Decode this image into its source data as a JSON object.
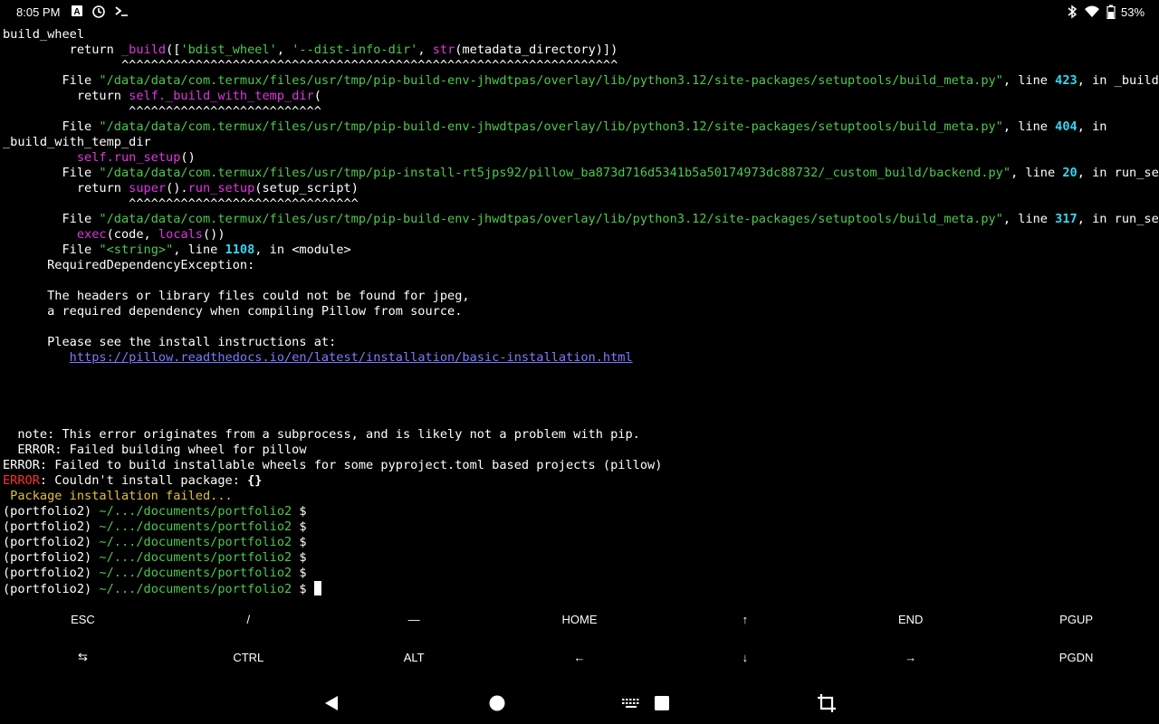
{
  "status_bar": {
    "time": "8:05 PM",
    "left_icons": [
      "a-box-icon",
      "sync-icon",
      "terminal-prompt-icon"
    ],
    "right_icons": [
      "bluetooth-icon",
      "wifi-icon",
      "battery-icon"
    ],
    "battery": "53%"
  },
  "terminal": {
    "lines": [
      [
        {
          "t": "build_wheel"
        }
      ],
      [
        {
          "t": "         return "
        },
        {
          "t": "_build",
          "c": "m"
        },
        {
          "t": "(["
        },
        {
          "t": "'bdist_wheel'",
          "c": "g"
        },
        {
          "t": ", "
        },
        {
          "t": "'--dist-info-dir'",
          "c": "g"
        },
        {
          "t": ", "
        },
        {
          "t": "str",
          "c": "m"
        },
        {
          "t": "(metadata_directory)])"
        }
      ],
      [
        {
          "t": "                ^^^^^^^^^^^^^^^^^^^^^^^^^^^^^^^^^^^^^^^^^^^^^^^^^^^^^^^^^^^^^^^^^^^"
        }
      ],
      [
        {
          "t": "        File "
        },
        {
          "t": "\"/data/data/com.termux/files/usr/tmp/pip-build-env-jhwdtpas/overlay/lib/python3.12/site-packages/setuptools/build_meta.py\"",
          "c": "g"
        },
        {
          "t": ", line "
        },
        {
          "t": "423",
          "c": "c"
        },
        {
          "t": ", in _build"
        }
      ],
      [
        {
          "t": "          return "
        },
        {
          "t": "self._build_with_temp_dir",
          "c": "m"
        },
        {
          "t": "("
        }
      ],
      [
        {
          "t": "                 ^^^^^^^^^^^^^^^^^^^^^^^^^^"
        }
      ],
      [
        {
          "t": "        File "
        },
        {
          "t": "\"/data/data/com.termux/files/usr/tmp/pip-build-env-jhwdtpas/overlay/lib/python3.12/site-packages/setuptools/build_meta.py\"",
          "c": "g"
        },
        {
          "t": ", line "
        },
        {
          "t": "404",
          "c": "c"
        },
        {
          "t": ", in"
        }
      ],
      [
        {
          "t": "_build_with_temp_dir"
        }
      ],
      [
        {
          "t": "          "
        },
        {
          "t": "self.run_setup",
          "c": "m"
        },
        {
          "t": "()"
        }
      ],
      [
        {
          "t": "        File "
        },
        {
          "t": "\"/data/data/com.termux/files/usr/tmp/pip-install-rt5jps92/pillow_ba873d716d5341b5a50174973dc88732/_custom_build/backend.py\"",
          "c": "g"
        },
        {
          "t": ", line "
        },
        {
          "t": "20",
          "c": "c"
        },
        {
          "t": ", in run_setup"
        }
      ],
      [
        {
          "t": "          return "
        },
        {
          "t": "super",
          "c": "m"
        },
        {
          "t": "()."
        },
        {
          "t": "run_setup",
          "c": "m"
        },
        {
          "t": "(setup_script)"
        }
      ],
      [
        {
          "t": "                 ^^^^^^^^^^^^^^^^^^^^^^^^^^^^^^^"
        }
      ],
      [
        {
          "t": "        File "
        },
        {
          "t": "\"/data/data/com.termux/files/usr/tmp/pip-build-env-jhwdtpas/overlay/lib/python3.12/site-packages/setuptools/build_meta.py\"",
          "c": "g"
        },
        {
          "t": ", line "
        },
        {
          "t": "317",
          "c": "c"
        },
        {
          "t": ", in run_setup"
        }
      ],
      [
        {
          "t": "          "
        },
        {
          "t": "exec",
          "c": "m"
        },
        {
          "t": "(code, "
        },
        {
          "t": "locals",
          "c": "m"
        },
        {
          "t": "())"
        }
      ],
      [
        {
          "t": "        File "
        },
        {
          "t": "\"<string>\"",
          "c": "g"
        },
        {
          "t": ", line "
        },
        {
          "t": "1108",
          "c": "c"
        },
        {
          "t": ", in <module>"
        }
      ],
      [
        {
          "t": "      RequiredDependencyException:"
        }
      ],
      [
        {
          "t": ""
        }
      ],
      [
        {
          "t": "      The headers or library files could not be found for jpeg,"
        }
      ],
      [
        {
          "t": "      a required dependency when compiling Pillow from source."
        }
      ],
      [
        {
          "t": ""
        }
      ],
      [
        {
          "t": "      Please see the install instructions at:"
        }
      ],
      [
        {
          "t": "         "
        },
        {
          "t": "https://pillow.readthedocs.io/en/latest/installation/basic-installation.html",
          "c": "link"
        }
      ],
      [
        {
          "t": ""
        }
      ],
      [
        {
          "t": ""
        }
      ],
      [
        {
          "t": ""
        }
      ],
      [
        {
          "t": ""
        }
      ],
      [
        {
          "t": "  note: This error originates from a subprocess, and is likely not a problem with pip."
        }
      ],
      [
        {
          "t": "  ERROR: Failed building wheel for pillow"
        }
      ],
      [
        {
          "t": "ERROR: Failed to build installable wheels for some pyproject.toml based projects (pillow)"
        }
      ],
      [
        {
          "t": "ERROR",
          "c": "r"
        },
        {
          "t": ": Couldn't install package: "
        },
        {
          "t": "{}",
          "c": "b"
        }
      ],
      [
        {
          "t": " Package installation failed...",
          "c": "y"
        }
      ],
      [
        {
          "t": "(portfolio2) "
        },
        {
          "t": "~/.../documents/portfolio2",
          "c": "g"
        },
        {
          "t": " $"
        }
      ],
      [
        {
          "t": "(portfolio2) "
        },
        {
          "t": "~/.../documents/portfolio2",
          "c": "g"
        },
        {
          "t": " $"
        }
      ],
      [
        {
          "t": "(portfolio2) "
        },
        {
          "t": "~/.../documents/portfolio2",
          "c": "g"
        },
        {
          "t": " $"
        }
      ],
      [
        {
          "t": "(portfolio2) "
        },
        {
          "t": "~/.../documents/portfolio2",
          "c": "g"
        },
        {
          "t": " $"
        }
      ],
      [
        {
          "t": "(portfolio2) "
        },
        {
          "t": "~/.../documents/portfolio2",
          "c": "g"
        },
        {
          "t": " $"
        }
      ],
      [
        {
          "t": "(portfolio2) "
        },
        {
          "t": "~/.../documents/portfolio2",
          "c": "g"
        },
        {
          "t": " $ "
        },
        {
          "cursor": true
        }
      ]
    ]
  },
  "extra_keys": {
    "row1": [
      "ESC",
      "/",
      "—",
      "HOME",
      "↑",
      "END",
      "PGUP"
    ],
    "row2": [
      "⇆",
      "CTRL",
      "ALT",
      "←",
      "↓",
      "→",
      "PGDN"
    ]
  },
  "nav_bar": {
    "buttons": [
      "back-icon",
      "home-icon",
      "keyboard-icon",
      "recents-icon",
      "crop-icon"
    ]
  }
}
